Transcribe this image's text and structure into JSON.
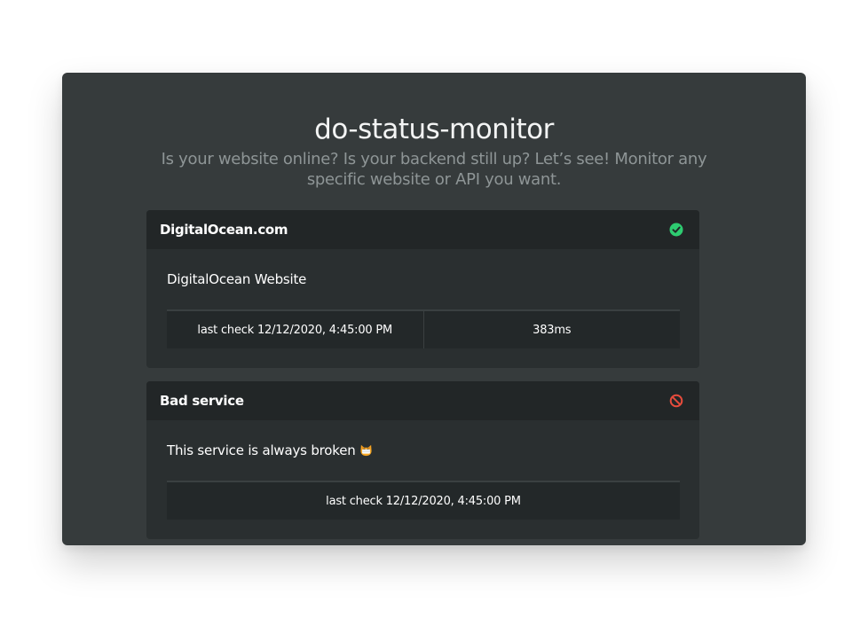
{
  "app": {
    "title": "do-status-monitor",
    "subtitle": "Is your website online? Is your backend still up? Let’s see! Monitor any specific website or API you want."
  },
  "services": [
    {
      "name": "DigitalOcean.com",
      "status": "up",
      "status_icon": "check-circle-icon",
      "status_color": "#2ecc71",
      "description": "DigitalOcean Website",
      "last_check": "last check 12/12/2020, 4:45:00 PM",
      "response_time": "383ms"
    },
    {
      "name": "Bad service",
      "status": "down",
      "status_icon": "ban-icon",
      "status_color": "#e74c3c",
      "description": "This service is always broken",
      "emoji": "cat-emoji",
      "last_check": "last check 12/12/2020, 4:45:00 PM"
    }
  ],
  "colors": {
    "background": "#363b3c",
    "card": "#2a2f30",
    "card_header": "#222627",
    "up": "#2ecc71",
    "down": "#e74c3c"
  }
}
